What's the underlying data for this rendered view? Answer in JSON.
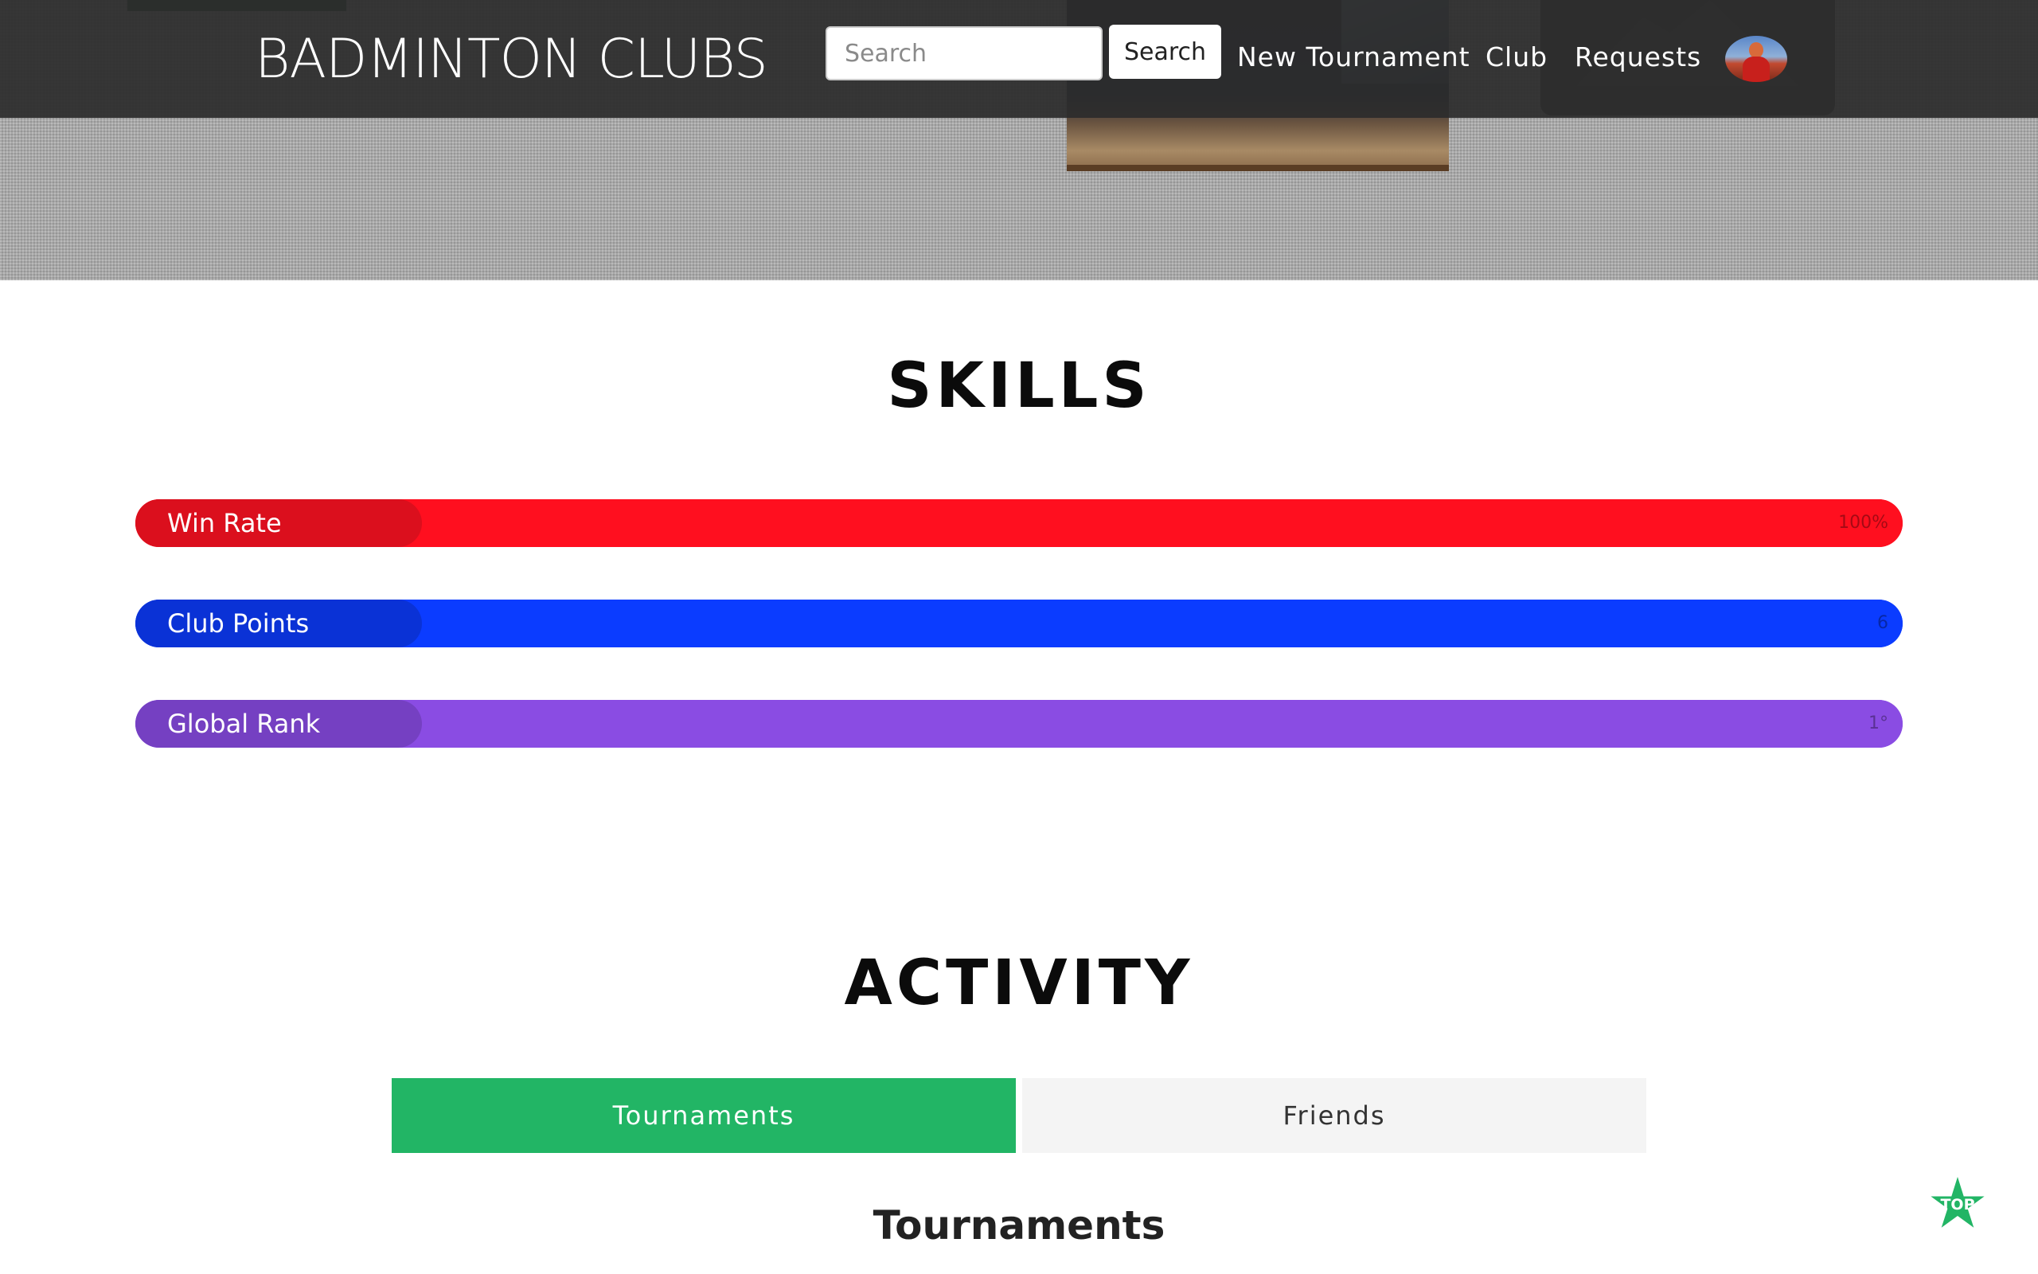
{
  "header": {
    "brand": "BADMINTON CLUBS",
    "search_placeholder": "Search",
    "search_button": "Search",
    "nav": [
      "New Tournament",
      "Club",
      "Requests"
    ]
  },
  "skills": {
    "title": "SKILLS",
    "bars": [
      {
        "label": "Win Rate",
        "value": "100%",
        "fill_fraction": 1.0,
        "color": "#ff0f1f",
        "label_color": "#db0f1d"
      },
      {
        "label": "Club Points",
        "value": "6",
        "fill_fraction": 1.0,
        "color": "#0b3cff",
        "label_color": "#0a32d6"
      },
      {
        "label": "Global Rank",
        "value": "1°",
        "fill_fraction": 1.0,
        "color": "#8a4ce3",
        "label_color": "#7540c2"
      }
    ]
  },
  "activity": {
    "title": "ACTIVITY",
    "tabs": [
      {
        "label": "Tournaments",
        "active": true
      },
      {
        "label": "Friends",
        "active": false
      }
    ],
    "subtitle": "Tournaments",
    "accent": "#22b565"
  },
  "back_to_top": {
    "label": "TOP",
    "icon": "star-icon"
  }
}
